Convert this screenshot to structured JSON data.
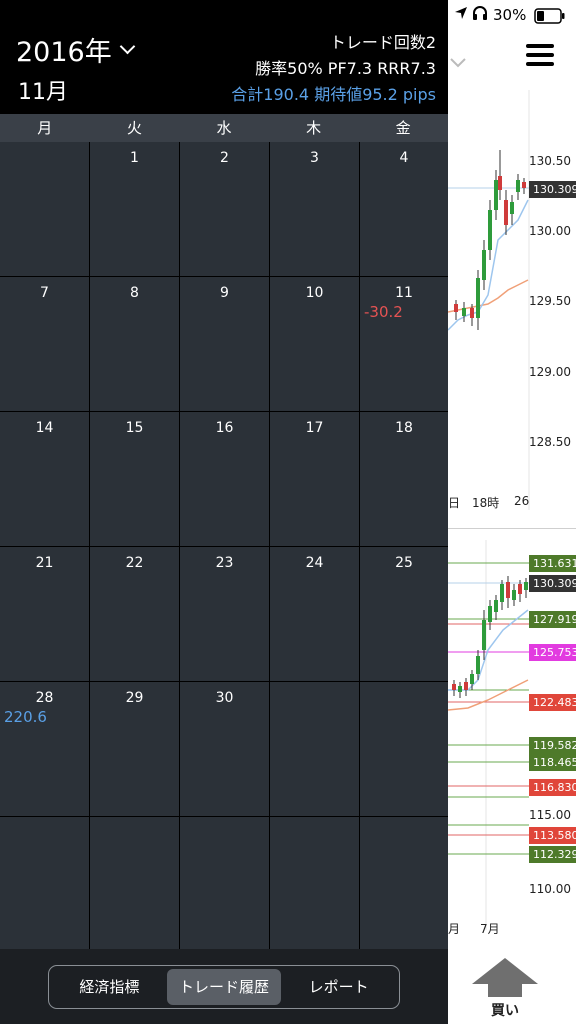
{
  "status": {
    "battery_pct": "30%",
    "icons": [
      "location-icon",
      "headphones-icon",
      "battery-icon"
    ]
  },
  "header": {
    "year": "2016年",
    "month": "11月",
    "trade_count": "トレード回数2",
    "ratios": "勝率50% PF7.3 RRR7.3",
    "total": "合計190.4 期待値95.2 pips"
  },
  "weekdays": [
    "月",
    "火",
    "水",
    "木",
    "金"
  ],
  "calendar": [
    [
      {
        "day": ""
      },
      {
        "day": "1"
      },
      {
        "day": "2"
      },
      {
        "day": "3"
      },
      {
        "day": "4"
      }
    ],
    [
      {
        "day": "7"
      },
      {
        "day": "8"
      },
      {
        "day": "9"
      },
      {
        "day": "10"
      },
      {
        "day": "11",
        "pnl": "-30.2",
        "sign": "neg"
      }
    ],
    [
      {
        "day": "14"
      },
      {
        "day": "15"
      },
      {
        "day": "16"
      },
      {
        "day": "17"
      },
      {
        "day": "18"
      }
    ],
    [
      {
        "day": "21"
      },
      {
        "day": "22"
      },
      {
        "day": "23"
      },
      {
        "day": "24"
      },
      {
        "day": "25"
      }
    ],
    [
      {
        "day": "28",
        "pnl": "220.6",
        "sign": "pos"
      },
      {
        "day": "29"
      },
      {
        "day": "30"
      },
      {
        "day": ""
      },
      {
        "day": ""
      }
    ],
    [
      {
        "day": ""
      },
      {
        "day": ""
      },
      {
        "day": ""
      },
      {
        "day": ""
      },
      {
        "day": ""
      }
    ]
  ],
  "tabs": {
    "econ": "経済指標",
    "history": "トレード履歴",
    "report": "レポート"
  },
  "chart_top": {
    "axis_labels": [
      "130.50",
      "130.00",
      "129.50",
      "129.00",
      "128.50"
    ],
    "current_price": "130.309",
    "x_labels": [
      "日",
      "18時",
      "26"
    ]
  },
  "chart_bottom": {
    "axis_labels": [
      "115.00",
      "110.00"
    ],
    "x_labels": [
      "月",
      "7月"
    ],
    "tags": [
      {
        "value": "131.631",
        "color": "#4e7a2a"
      },
      {
        "value": "130.309",
        "color": "#333333"
      },
      {
        "value": "127.919",
        "color": "#4e7a2a"
      },
      {
        "value": "125.753",
        "color": "#e23be0"
      },
      {
        "value": "122.483",
        "color": "#e0463a"
      },
      {
        "value": "119.582",
        "color": "#4e7a2a"
      },
      {
        "value": "118.465",
        "color": "#4e7a2a"
      },
      {
        "value": "116.830",
        "color": "#e0463a"
      },
      {
        "value": "113.580",
        "color": "#e0463a"
      },
      {
        "value": "112.329",
        "color": "#4e7a2a"
      }
    ]
  },
  "buy_label": "買い"
}
